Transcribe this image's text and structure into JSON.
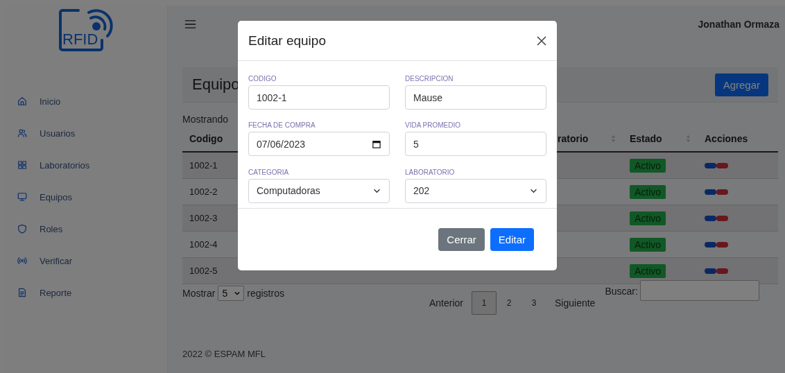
{
  "sidebar": {
    "logo": "RFID",
    "items": [
      {
        "label": "Inicio"
      },
      {
        "label": "Usuarios"
      },
      {
        "label": "Laboratorios"
      },
      {
        "label": "Equipos"
      },
      {
        "label": "Roles"
      },
      {
        "label": "Verificar"
      },
      {
        "label": "Reporte"
      }
    ]
  },
  "topbar": {
    "user": "Jonathan Ormaza"
  },
  "page": {
    "title": "Equipo",
    "add_button": "Agregar",
    "info": "Mostrando"
  },
  "table": {
    "columns": [
      {
        "label": "Codigo"
      },
      {
        "label": "ratorio",
        "sortable": true
      },
      {
        "label": "Estado",
        "sortable": true
      },
      {
        "label": "Acciones",
        "sortable": false
      }
    ],
    "rows": [
      {
        "codigo": "1002-1",
        "estado": "Activo"
      },
      {
        "codigo": "1002-2",
        "estado": "Activo"
      },
      {
        "codigo": "1002-3",
        "estado": "Activo"
      },
      {
        "codigo": "1002-4",
        "estado": "Activo"
      },
      {
        "codigo": "1002-5",
        "estado": "Activo"
      }
    ]
  },
  "length_menu": {
    "before": "Mostrar",
    "value": "5",
    "after": "registros"
  },
  "pagination": {
    "previous": "Anterior",
    "next": "Siguiente",
    "pages": [
      {
        "label": "1",
        "selected": true
      },
      {
        "label": "2",
        "selected": false
      },
      {
        "label": "3",
        "selected": false
      }
    ]
  },
  "search": {
    "label": "Buscar:"
  },
  "footer": "2022 © ESPAM MFL",
  "modal": {
    "title": "Editar equipo",
    "fields": [
      {
        "label": "CODIGO",
        "value": "1002-1",
        "kind": "text"
      },
      {
        "label": "DESCRIPCION",
        "value": "Mause",
        "kind": "text"
      },
      {
        "label": "FECHA DE COMPRA",
        "value": "07/06/2023",
        "kind": "date"
      },
      {
        "label": "VIDA PROMEDIO",
        "value": "5",
        "kind": "text"
      },
      {
        "label": "CATEGORIA",
        "value": "Computadoras",
        "kind": "select"
      },
      {
        "label": "LABORATORIO",
        "value": "202",
        "kind": "select"
      }
    ],
    "buttons": [
      {
        "label": "Cerrar",
        "kind": "secondary"
      },
      {
        "label": "Editar",
        "kind": "primary"
      }
    ]
  }
}
